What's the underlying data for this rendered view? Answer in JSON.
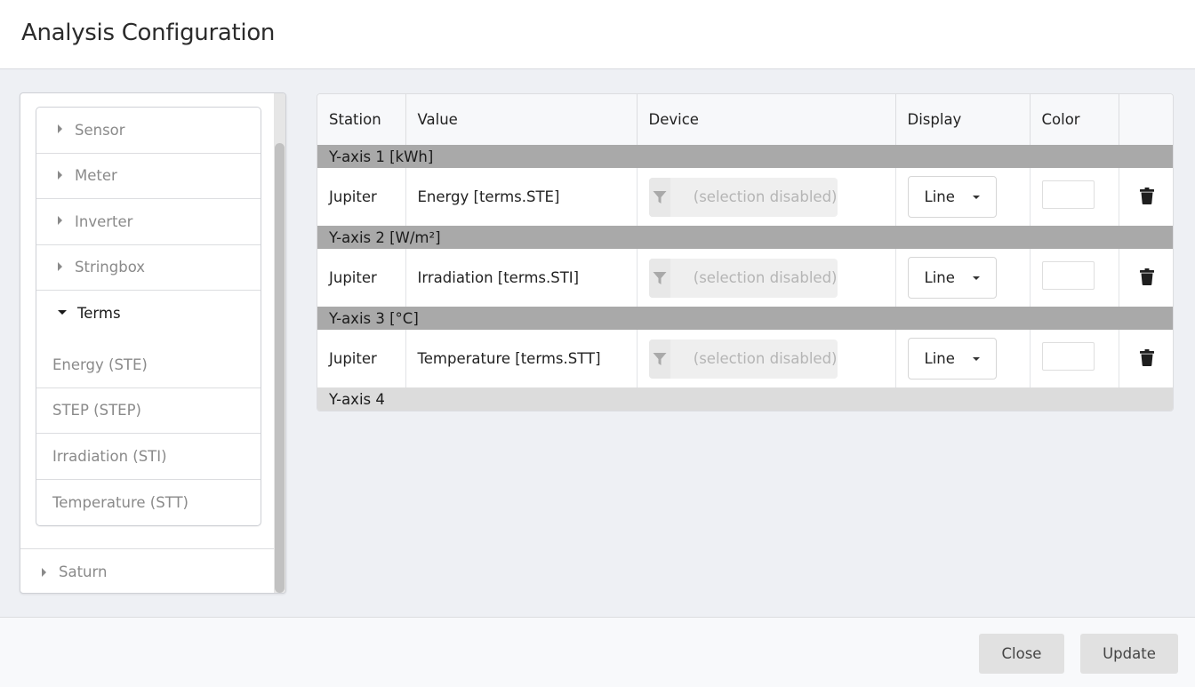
{
  "dialog": {
    "title": "Analysis Configuration"
  },
  "tree": {
    "stations": [
      {
        "name": "Jupiter",
        "categories": [
          {
            "label": "Sensor",
            "expanded": false
          },
          {
            "label": "Meter",
            "expanded": false
          },
          {
            "label": "Inverter",
            "expanded": false
          },
          {
            "label": "Stringbox",
            "expanded": false
          },
          {
            "label": "Terms",
            "expanded": true,
            "children": [
              "Energy (STE)",
              "STEP (STEP)",
              "Irradiation (STI)",
              "Temperature (STT)"
            ]
          }
        ]
      },
      {
        "name": "Saturn",
        "expanded": false
      }
    ]
  },
  "table": {
    "columns": [
      "Station",
      "Value",
      "Device",
      "Display",
      "Color",
      ""
    ],
    "axes": [
      {
        "label": "Y-axis 1 [kWh]",
        "rows": [
          {
            "station": "Jupiter",
            "value": "Energy [terms.STE]",
            "device": "(selection disabled)",
            "display": "Line",
            "color": "#ffffff"
          }
        ]
      },
      {
        "label": "Y-axis 2 [W/m²]",
        "rows": [
          {
            "station": "Jupiter",
            "value": "Irradiation [terms.STI]",
            "device": "(selection disabled)",
            "display": "Line",
            "color": "#ffffff"
          }
        ]
      },
      {
        "label": "Y-axis 3 [°C]",
        "rows": [
          {
            "station": "Jupiter",
            "value": "Temperature [terms.STT]",
            "device": "(selection disabled)",
            "display": "Line",
            "color": "#ffffff"
          }
        ]
      },
      {
        "label": "Y-axis 4",
        "rows": []
      }
    ]
  },
  "footer": {
    "close_label": "Close",
    "update_label": "Update"
  },
  "icons": {
    "tree_collapsed": "caret-right-icon",
    "tree_expanded": "caret-down-icon",
    "device_filter": "filter-icon",
    "display_dropdown": "caret-down-icon",
    "row_delete": "trash-icon"
  }
}
